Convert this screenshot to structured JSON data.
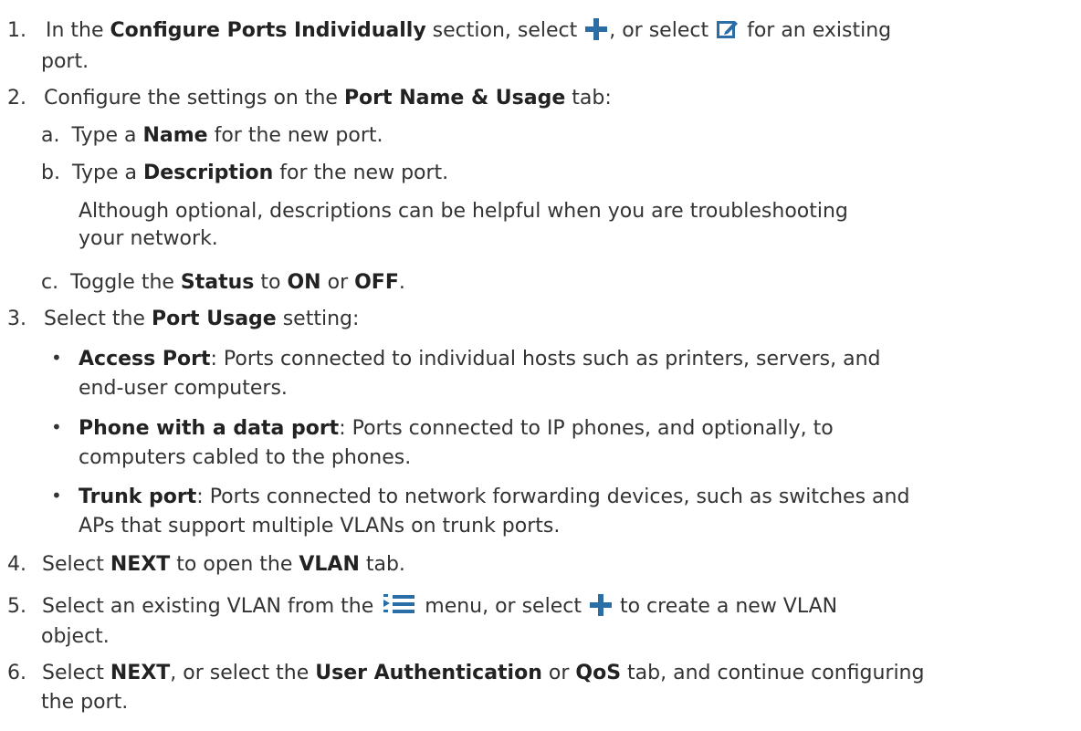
{
  "step1": {
    "num": "1.",
    "pre": "In the ",
    "bold1": "Configure Ports Individually",
    "mid": " section, select ",
    "mid2": ", or select ",
    "post": " for an existing",
    "cont": "port."
  },
  "step2": {
    "num": "2.",
    "pre": "Configure the settings on the ",
    "bold1": "Port Name & Usage",
    "post": " tab:",
    "a": {
      "letter": "a.",
      "pre": "Type a ",
      "bold": "Name",
      "post": " for the new port."
    },
    "b": {
      "letter": "b.",
      "pre": "Type a ",
      "bold": "Description",
      "post": " for the new port.",
      "note1": "Although optional, descriptions can be helpful when you are troubleshooting",
      "note2": "your network."
    },
    "c": {
      "letter": "c.",
      "pre": "Toggle the ",
      "bold1": "Status",
      "mid": " to ",
      "bold2": "ON",
      "mid2": " or ",
      "bold3": "OFF",
      "post": "."
    }
  },
  "step3": {
    "num": "3.",
    "pre": "Select the ",
    "bold": "Port Usage",
    "post": " setting:",
    "bullet": "•",
    "items": [
      {
        "bold": "Access Port",
        "text": ": Ports connected to individual hosts such as printers, servers, and",
        "cont": "end-user computers."
      },
      {
        "bold": "Phone with a data port",
        "text": ": Ports connected to IP phones, and optionally, to",
        "cont": "computers cabled to the phones."
      },
      {
        "bold": "Trunk port",
        "text": ": Ports connected to network forwarding devices, such as switches and",
        "cont": "APs that support multiple VLANs on trunk ports."
      }
    ]
  },
  "step4": {
    "num": "4.",
    "pre": "Select ",
    "bold1": "NEXT",
    "mid": " to open the ",
    "bold2": "VLAN",
    "post": " tab."
  },
  "step5": {
    "num": "5.",
    "pre": "Select an existing VLAN from the ",
    "mid": " menu, or select ",
    "post": " to create a new VLAN",
    "cont": "object."
  },
  "step6": {
    "num": "6.",
    "pre": "Select ",
    "bold1": "NEXT",
    "mid": ", or select the ",
    "bold2": "User Authentication",
    "mid2": " or ",
    "bold3": "QoS",
    "post": " tab, and continue configuring",
    "cont": "the port."
  },
  "icons": {
    "add": "plus-icon",
    "edit": "edit-icon",
    "list": "list-menu-icon",
    "color": "#2b6ea6"
  }
}
